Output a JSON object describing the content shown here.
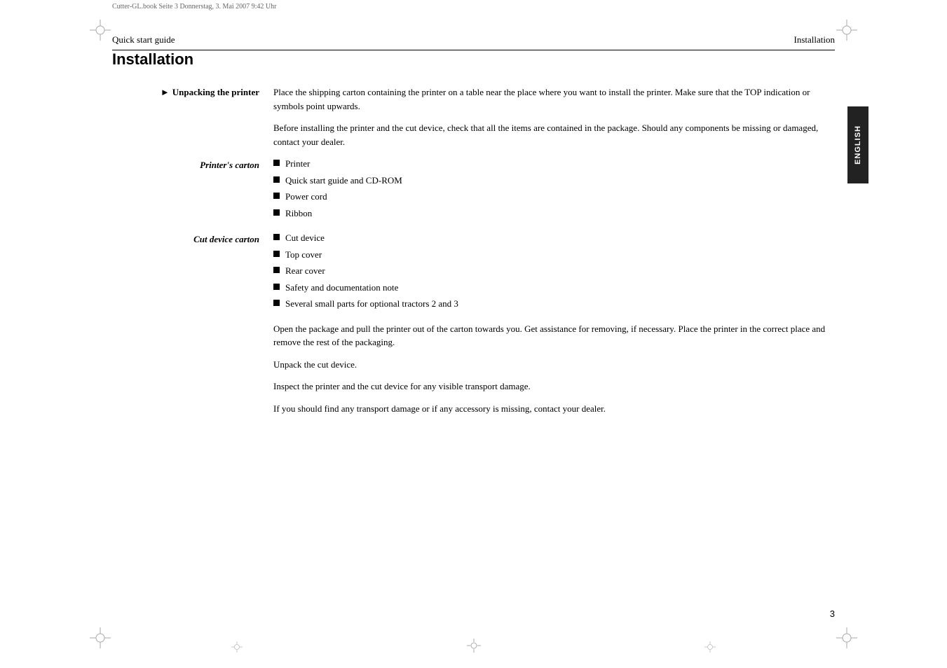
{
  "page": {
    "top_file_label": "Cutter-GL.book  Seite 3  Donnerstag, 3. Mai 2007  9:42 Uhr",
    "header_left": "Quick start guide",
    "header_right": "Installation",
    "page_number": "3",
    "title": "Installation",
    "english_tab": "ENGLISH"
  },
  "section": {
    "heading": "Unpacking the printer",
    "intro_para1": "Place the shipping carton containing the printer on a table near the place where you want to install the printer. Make sure that the TOP indication or symbols point upwards.",
    "intro_para2": "Before installing the printer and the cut device, check that all the items are contained in the package. Should any components be missing or damaged, contact your dealer.",
    "printers_carton_label": "Printer's carton",
    "printers_carton_items": [
      "Printer",
      "Quick start guide and CD-ROM",
      "Power cord",
      "Ribbon"
    ],
    "cut_device_carton_label": "Cut device carton",
    "cut_device_carton_items": [
      "Cut device",
      "Top cover",
      "Rear cover",
      "Safety and documentation note",
      "Several small parts for optional tractors 2 and 3"
    ],
    "closing_para1": "Open the package and pull the printer out of the carton towards you. Get assistance for removing, if necessary. Place the printer in the correct place and remove the rest of the packaging.",
    "closing_para2": "Unpack the cut device.",
    "closing_para3": "Inspect the printer and the cut device for any visible transport damage.",
    "closing_para4": "If you should find any transport damage or if any accessory is missing, contact your dealer."
  }
}
